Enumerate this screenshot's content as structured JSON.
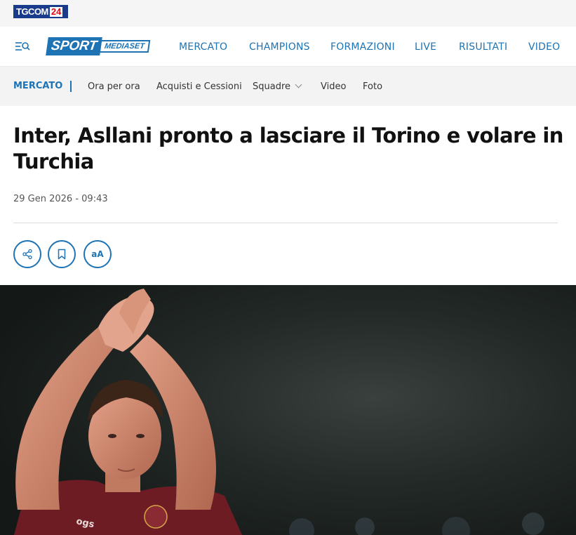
{
  "topbar": {
    "logo_text_1": "TGCOM",
    "logo_text_2": "24"
  },
  "brand": {
    "sport": "SPORT",
    "mediaset": "MEDIASET"
  },
  "mainnav": {
    "items": [
      {
        "label": "MERCATO"
      },
      {
        "label": "CHAMPIONS"
      },
      {
        "label": "FORMAZIONI"
      },
      {
        "label": "LIVE"
      },
      {
        "label": "RISULTATI"
      },
      {
        "label": "VIDEO"
      }
    ]
  },
  "subnav": {
    "category": "MERCATO",
    "items": [
      {
        "label": "Ora per ora"
      },
      {
        "label": "Acquisti e Cessioni"
      },
      {
        "label": "Squadre"
      },
      {
        "label": "Video"
      },
      {
        "label": "Foto"
      }
    ]
  },
  "article": {
    "title": "Inter, Asllani pronto a lasciare il Torino e volare in Turchia",
    "date": "29 Gen 2026 - 09:43",
    "font_size_button": "aA"
  },
  "colors": {
    "accent": "#1e73b4",
    "hero_bg": "#1c2220",
    "jersey": "#6e1c24"
  },
  "icons": [
    "menu-search-icon",
    "share-icon",
    "bookmark-icon",
    "font-size-icon",
    "chevron-down-icon"
  ]
}
